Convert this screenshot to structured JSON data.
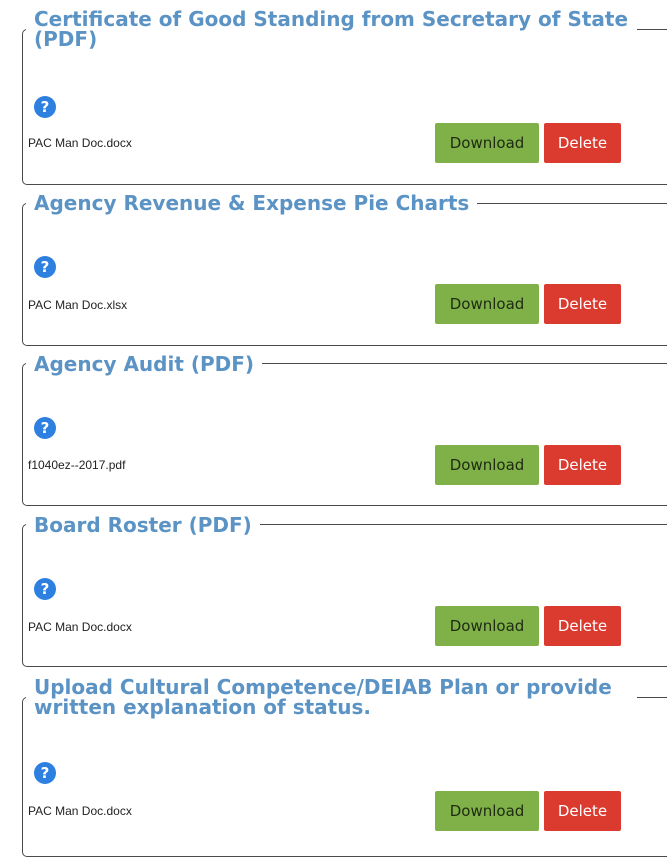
{
  "help_glyph": "?",
  "colors": {
    "heading": "#5b93c5",
    "help_icon": "#2d7fe0",
    "download_button": "#7fb148",
    "delete_button": "#db3a2f",
    "border": "#4a4a4a"
  },
  "sections": [
    {
      "title_line1": "Certificate of Good Standing from Secretary of State",
      "title_line2": "(PDF)",
      "file_name": "PAC Man Doc.docx",
      "download_label": "Download",
      "delete_label": "Delete"
    },
    {
      "title_line1": "Agency Revenue & Expense Pie Charts",
      "file_name": "PAC Man Doc.xlsx",
      "download_label": "Download",
      "delete_label": "Delete"
    },
    {
      "title_line1": "Agency Audit (PDF)",
      "file_name": "f1040ez--2017.pdf",
      "download_label": "Download",
      "delete_label": "Delete"
    },
    {
      "title_line1": "Board Roster (PDF)",
      "file_name": "PAC Man Doc.docx",
      "download_label": "Download",
      "delete_label": "Delete"
    },
    {
      "title_line1": "Upload Cultural Competence/DEIAB Plan or provide",
      "title_line2": "written explanation of status.",
      "file_name": "PAC Man Doc.docx",
      "download_label": "Download",
      "delete_label": "Delete"
    }
  ]
}
